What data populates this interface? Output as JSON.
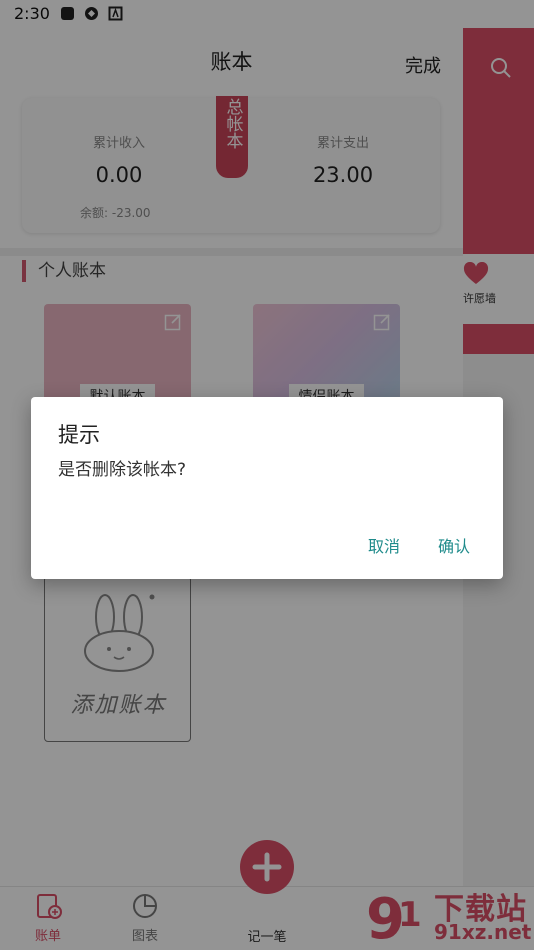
{
  "status_bar": {
    "time": "2:30"
  },
  "header": {
    "title": "账本",
    "done_label": "完成"
  },
  "summary": {
    "ribbon_text": "总帐本",
    "income_label": "累计收入",
    "income_value": "0.00",
    "expense_label": "累计支出",
    "expense_value": "23.00",
    "balance_text": "余额: -23.00"
  },
  "section": {
    "title": "个人账本"
  },
  "books": [
    {
      "name": "默认账本"
    },
    {
      "name": "情侣账本"
    }
  ],
  "add_book": {
    "label": "添加账本"
  },
  "drawer": {
    "text": "许愿墙"
  },
  "dialog": {
    "title": "提示",
    "message": "是否删除该帐本?",
    "cancel_label": "取消",
    "confirm_label": "确认"
  },
  "bottom_nav": {
    "items": [
      {
        "label": "账单"
      },
      {
        "label": "图表"
      },
      {
        "label": "记一笔"
      }
    ]
  },
  "watermark": {
    "line1": "下载站",
    "line2": "91xz.net"
  },
  "colors": {
    "accent": "#d94f67",
    "dialog_button": "#1f8b8b"
  }
}
